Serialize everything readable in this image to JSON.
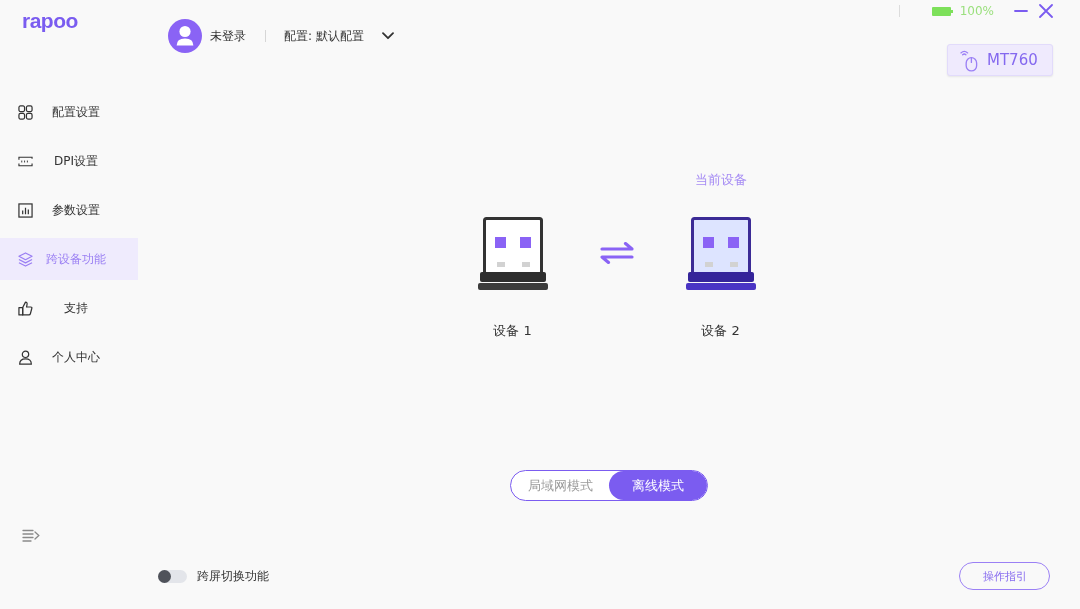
{
  "logo": "rapoo",
  "sidebar": {
    "items": [
      {
        "label": "配置设置",
        "selected": false
      },
      {
        "label": "DPI设置",
        "selected": false
      },
      {
        "label": "参数设置",
        "selected": false
      },
      {
        "label": "跨设备功能",
        "selected": true
      },
      {
        "label": "支持",
        "selected": false
      },
      {
        "label": "个人中心",
        "selected": false
      }
    ]
  },
  "user": {
    "name": "未登录"
  },
  "profile": {
    "label": "配置: 默认配置"
  },
  "battery": {
    "reading": "100%"
  },
  "device_badge": {
    "name": "MT760"
  },
  "devices": {
    "current_label": "当前设备",
    "items": [
      {
        "label": "设备 1",
        "current": false
      },
      {
        "label": "设备 2",
        "current": true
      }
    ]
  },
  "modes": [
    {
      "label": "局域网模式",
      "selected": false
    },
    {
      "label": "离线模式",
      "selected": true
    }
  ],
  "cross_screen": {
    "label": "跨屏切换功能",
    "on": false
  },
  "guide_button": {
    "label": "操作指引"
  }
}
